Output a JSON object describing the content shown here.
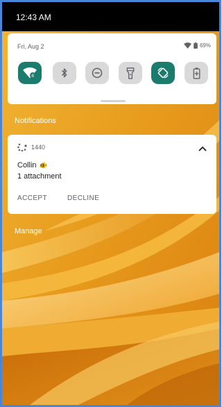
{
  "status_bar": {
    "time": "12:43 AM"
  },
  "quick_settings": {
    "date": "Fri, Aug 2",
    "battery": "69%",
    "tiles": [
      {
        "icon": "wifi-icon",
        "state": "on",
        "badge": "6"
      },
      {
        "icon": "bluetooth-icon",
        "state": "off"
      },
      {
        "icon": "do-not-disturb-icon",
        "state": "off"
      },
      {
        "icon": "flashlight-icon",
        "state": "off"
      },
      {
        "icon": "auto-rotate-icon",
        "state": "on"
      },
      {
        "icon": "battery-saver-icon",
        "state": "off"
      }
    ],
    "accent_color": "#1b7c6e",
    "inactive_tile_color": "#d9d9d9"
  },
  "notifications": {
    "header": "Notifications",
    "items": [
      {
        "app_icon": "loading-spinner-icon",
        "app_name": "1440",
        "title": "Collin",
        "title_emoji": "🐠",
        "text": "1 attachment",
        "actions": {
          "accept": "ACCEPT",
          "decline": "DECLINE"
        },
        "expanded": true
      }
    ]
  },
  "manage_label": "Manage"
}
